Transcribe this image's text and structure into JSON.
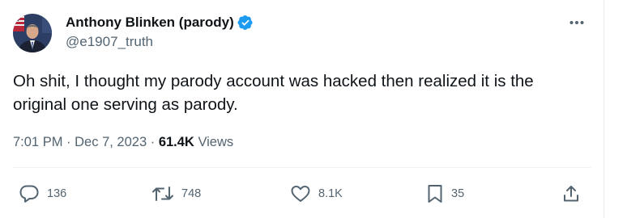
{
  "author": {
    "display_name": "Anthony Blinken (parody)",
    "handle": "@e1907_truth",
    "verified": true,
    "avatar_icon": "person-photo-avatar"
  },
  "more_icon": "more-options-icon",
  "tweet": {
    "text": "Oh shit, I thought my parody account was hacked then realized it is the original one serving as parody."
  },
  "meta": {
    "time": "7:01 PM",
    "separator": "·",
    "date": "Dec 7, 2023",
    "views_count": "61.4K",
    "views_label": "Views"
  },
  "actions": {
    "replies": "136",
    "reposts": "748",
    "likes": "8.1K",
    "bookmarks": "35"
  },
  "colors": {
    "primary_text": "#0f1419",
    "secondary_text": "#536471",
    "verified_badge": "#1d9bf0",
    "divider": "#eff3f4"
  }
}
